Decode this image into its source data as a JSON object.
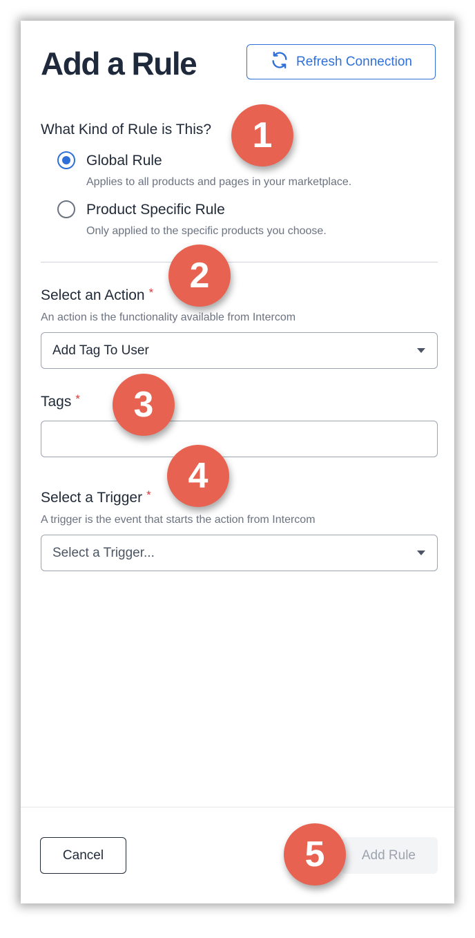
{
  "header": {
    "title": "Add a Rule",
    "refresh_label": "Refresh Connection"
  },
  "rule_kind": {
    "label": "What Kind of Rule is This?",
    "options": [
      {
        "label": "Global Rule",
        "help": "Applies to all products and pages in your marketplace.",
        "checked": true
      },
      {
        "label": "Product Specific Rule",
        "help": "Only applied to the specific products you choose.",
        "checked": false
      }
    ]
  },
  "action": {
    "label": "Select an Action",
    "required_mark": "*",
    "help": "An action is the functionality available from Intercom",
    "value": "Add Tag To User"
  },
  "tags": {
    "label": "Tags",
    "required_mark": "*",
    "value": ""
  },
  "trigger": {
    "label": "Select a Trigger",
    "required_mark": "*",
    "help": "A trigger is the event that starts the action from Intercom",
    "placeholder": "Select a Trigger..."
  },
  "footer": {
    "cancel_label": "Cancel",
    "add_label": "Add Rule"
  },
  "step_markers": [
    "1",
    "2",
    "3",
    "4",
    "5"
  ],
  "colors": {
    "accent": "#2f6fd8",
    "marker": "#e76250",
    "required": "#d93838"
  },
  "icons": {
    "refresh": "refresh-icon",
    "dropdown": "chevron-down-icon"
  }
}
